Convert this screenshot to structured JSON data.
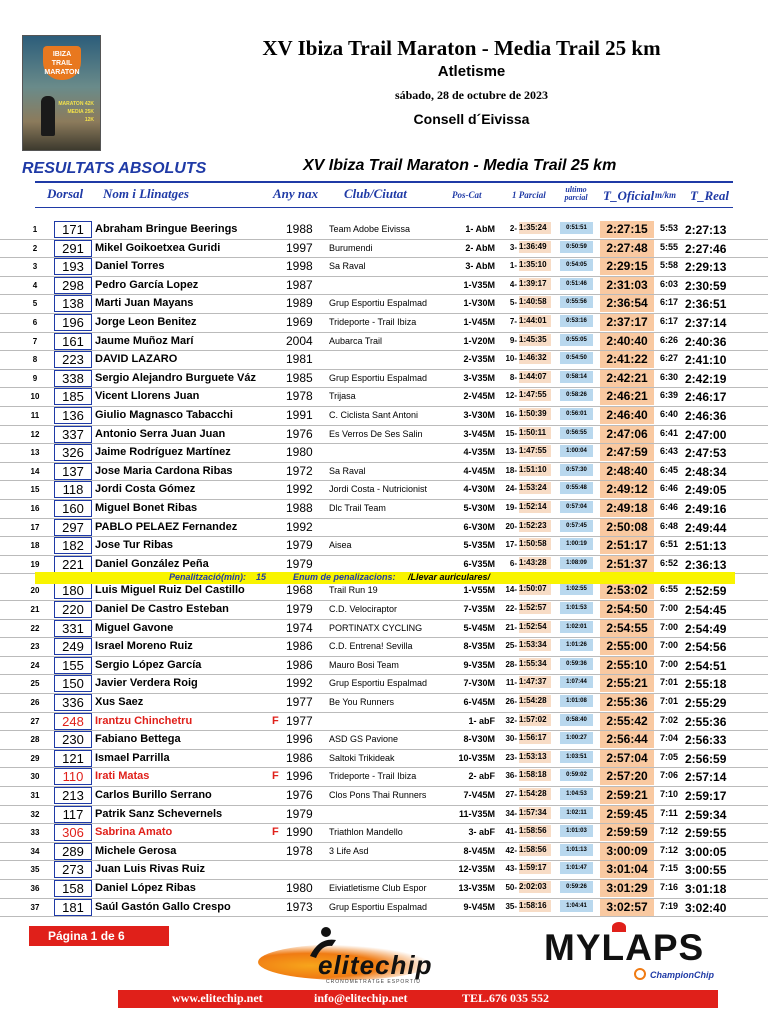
{
  "header": {
    "title": "XV Ibiza Trail Maraton - Media Trail 25 km",
    "subtitle": "Atletisme",
    "date": "sábado, 28 de octubre de 2023",
    "organizer": "Consell d´Eivissa"
  },
  "poster": {
    "lines": [
      "IBIZA",
      "TRAIL",
      "MARATON"
    ],
    "distances": [
      "MARATON 42K",
      "MEDIA 25K",
      "12K"
    ]
  },
  "section_title": "RESULTATS ABSOLUTS",
  "race_title": "XV Ibiza Trail Maraton - Media Trail 25 km",
  "columns": {
    "dorsal": "Dorsal",
    "name": "Nom i Llinatges",
    "year": "Any nax",
    "club": "Club/Ciutat",
    "poscat": "Pos-Cat",
    "parcial1": "1 Parcial",
    "ultimo": "ultimo parcial",
    "toficial": "T_Oficial",
    "mkm": "m/km",
    "treal": "T_Real"
  },
  "results": [
    {
      "pos": "1",
      "dorsal": "171",
      "name": "Abraham Bringue  Beerings",
      "sex": "",
      "year": "1988",
      "club": "Team Adobe Eivissa",
      "cat": "1- AbM",
      "p1pos": "2-",
      "p1": "1:35:24",
      "last": "0:51:51",
      "toficial": "2:27:15",
      "mkm": "5:53",
      "treal": "2:27:13"
    },
    {
      "pos": "2",
      "dorsal": "291",
      "name": "Mikel Goikoetxea Guridi",
      "sex": "",
      "year": "1997",
      "club": "Burumendi",
      "cat": "2- AbM",
      "p1pos": "3-",
      "p1": "1:36:49",
      "last": "0:50:59",
      "toficial": "2:27:48",
      "mkm": "5:55",
      "treal": "2:27:46"
    },
    {
      "pos": "3",
      "dorsal": "193",
      "name": "Daniel Torres",
      "sex": "",
      "year": "1998",
      "club": "Sa Raval",
      "cat": "3- AbM",
      "p1pos": "1-",
      "p1": "1:35:10",
      "last": "0:54:05",
      "toficial": "2:29:15",
      "mkm": "5:58",
      "treal": "2:29:13"
    },
    {
      "pos": "4",
      "dorsal": "298",
      "name": "Pedro García Lopez",
      "sex": "",
      "year": "1987",
      "club": "",
      "cat": "1-V35M",
      "p1pos": "4-",
      "p1": "1:39:17",
      "last": "0:51:46",
      "toficial": "2:31:03",
      "mkm": "6:03",
      "treal": "2:30:59"
    },
    {
      "pos": "5",
      "dorsal": "138",
      "name": "Marti Juan Mayans",
      "sex": "",
      "year": "1989",
      "club": "Grup Esportiu Espalmad",
      "cat": "1-V30M",
      "p1pos": "5-",
      "p1": "1:40:58",
      "last": "0:55:56",
      "toficial": "2:36:54",
      "mkm": "6:17",
      "treal": "2:36:51"
    },
    {
      "pos": "6",
      "dorsal": "196",
      "name": "Jorge Leon Benitez",
      "sex": "",
      "year": "1969",
      "club": "Trideporte - Trail Ibiza",
      "cat": "1-V45M",
      "p1pos": "7-",
      "p1": "1:44:01",
      "last": "0:53:16",
      "toficial": "2:37:17",
      "mkm": "6:17",
      "treal": "2:37:14"
    },
    {
      "pos": "7",
      "dorsal": "161",
      "name": "Jaume  Muñoz Marí",
      "sex": "",
      "year": "2004",
      "club": "Aubarca Trail",
      "cat": "1-V20M",
      "p1pos": "9-",
      "p1": "1:45:35",
      "last": "0:55:05",
      "toficial": "2:40:40",
      "mkm": "6:26",
      "treal": "2:40:36"
    },
    {
      "pos": "8",
      "dorsal": "223",
      "name": "DAVID LAZARO",
      "sex": "",
      "year": "1981",
      "club": "",
      "cat": "2-V35M",
      "p1pos": "10-",
      "p1": "1:46:32",
      "last": "0:54:50",
      "toficial": "2:41:22",
      "mkm": "6:27",
      "treal": "2:41:10"
    },
    {
      "pos": "9",
      "dorsal": "338",
      "name": "Sergio Alejandro Burguete  Váz",
      "sex": "",
      "year": "1985",
      "club": "Grup Esportiu Espalmad",
      "cat": "3-V35M",
      "p1pos": "8-",
      "p1": "1:44:07",
      "last": "0:58:14",
      "toficial": "2:42:21",
      "mkm": "6:30",
      "treal": "2:42:19"
    },
    {
      "pos": "10",
      "dorsal": "185",
      "name": "Vicent Llorens Juan",
      "sex": "",
      "year": "1978",
      "club": "Trijasa",
      "cat": "2-V45M",
      "p1pos": "12-",
      "p1": "1:47:55",
      "last": "0:58:26",
      "toficial": "2:46:21",
      "mkm": "6:39",
      "treal": "2:46:17"
    },
    {
      "pos": "11",
      "dorsal": "136",
      "name": "Giulio Magnasco Tabacchi",
      "sex": "",
      "year": "1991",
      "club": "C. Ciclista Sant Antoni",
      "cat": "3-V30M",
      "p1pos": "16-",
      "p1": "1:50:39",
      "last": "0:56:01",
      "toficial": "2:46:40",
      "mkm": "6:40",
      "treal": "2:46:36"
    },
    {
      "pos": "12",
      "dorsal": "337",
      "name": "Antonio Serra Juan Juan",
      "sex": "",
      "year": "1976",
      "club": "Es Verros De Ses Salin",
      "cat": "3-V45M",
      "p1pos": "15-",
      "p1": "1:50:11",
      "last": "0:56:55",
      "toficial": "2:47:06",
      "mkm": "6:41",
      "treal": "2:47:00"
    },
    {
      "pos": "13",
      "dorsal": "326",
      "name": "Jaime Rodríguez Martínez",
      "sex": "",
      "year": "1980",
      "club": "",
      "cat": "4-V35M",
      "p1pos": "13-",
      "p1": "1:47:55",
      "last": "1:00:04",
      "toficial": "2:47:59",
      "mkm": "6:43",
      "treal": "2:47:53"
    },
    {
      "pos": "14",
      "dorsal": "137",
      "name": "Jose Maria Cardona Ribas",
      "sex": "",
      "year": "1972",
      "club": "Sa Raval",
      "cat": "4-V45M",
      "p1pos": "18-",
      "p1": "1:51:10",
      "last": "0:57:30",
      "toficial": "2:48:40",
      "mkm": "6:45",
      "treal": "2:48:34"
    },
    {
      "pos": "15",
      "dorsal": "118",
      "name": "Jordi Costa Gómez",
      "sex": "",
      "year": "1992",
      "club": "Jordi Costa - Nutricionist",
      "cat": "4-V30M",
      "p1pos": "24-",
      "p1": "1:53:24",
      "last": "0:55:48",
      "toficial": "2:49:12",
      "mkm": "6:46",
      "treal": "2:49:05"
    },
    {
      "pos": "16",
      "dorsal": "160",
      "name": "Miguel Bonet Ribas",
      "sex": "",
      "year": "1988",
      "club": "Dlc Trail Team",
      "cat": "5-V30M",
      "p1pos": "19-",
      "p1": "1:52:14",
      "last": "0:57:04",
      "toficial": "2:49:18",
      "mkm": "6:46",
      "treal": "2:49:16"
    },
    {
      "pos": "17",
      "dorsal": "297",
      "name": "PABLO PELAEZ Fernandez",
      "sex": "",
      "year": "1992",
      "club": "",
      "cat": "6-V30M",
      "p1pos": "20-",
      "p1": "1:52:23",
      "last": "0:57:45",
      "toficial": "2:50:08",
      "mkm": "6:48",
      "treal": "2:49:44"
    },
    {
      "pos": "18",
      "dorsal": "182",
      "name": "Jose Tur Ribas",
      "sex": "",
      "year": "1979",
      "club": "Aisea",
      "cat": "5-V35M",
      "p1pos": "17-",
      "p1": "1:50:58",
      "last": "1:00:19",
      "toficial": "2:51:17",
      "mkm": "6:51",
      "treal": "2:51:13"
    },
    {
      "pos": "19",
      "dorsal": "221",
      "name": "Daniel González Peña",
      "sex": "",
      "year": "1979",
      "club": "",
      "cat": "6-V35M",
      "p1pos": "6-",
      "p1": "1:43:28",
      "last": "1:08:09",
      "toficial": "2:51:37",
      "mkm": "6:52",
      "treal": "2:36:13"
    },
    {
      "pos": "20",
      "dorsal": "180",
      "name": "Luis Miguel  Ruiz  Del Castillo",
      "sex": "",
      "year": "1968",
      "club": "Trail Run 19",
      "cat": "1-V55M",
      "p1pos": "14-",
      "p1": "1:50:07",
      "last": "1:02:55",
      "toficial": "2:53:02",
      "mkm": "6:55",
      "treal": "2:52:59"
    },
    {
      "pos": "21",
      "dorsal": "220",
      "name": "Daniel  De Castro  Esteban",
      "sex": "",
      "year": "1979",
      "club": "C.D. Velociraptor",
      "cat": "7-V35M",
      "p1pos": "22-",
      "p1": "1:52:57",
      "last": "1:01:53",
      "toficial": "2:54:50",
      "mkm": "7:00",
      "treal": "2:54:45"
    },
    {
      "pos": "22",
      "dorsal": "331",
      "name": "Miguel Gavone",
      "sex": "",
      "year": "1974",
      "club": "PORTINATX CYCLING",
      "cat": "5-V45M",
      "p1pos": "21-",
      "p1": "1:52:54",
      "last": "1:02:01",
      "toficial": "2:54:55",
      "mkm": "7:00",
      "treal": "2:54:49"
    },
    {
      "pos": "23",
      "dorsal": "249",
      "name": "Israel Moreno  Ruiz",
      "sex": "",
      "year": "1986",
      "club": "C.D. Entrena! Sevilla",
      "cat": "8-V35M",
      "p1pos": "25-",
      "p1": "1:53:34",
      "last": "1:01:26",
      "toficial": "2:55:00",
      "mkm": "7:00",
      "treal": "2:54:56"
    },
    {
      "pos": "24",
      "dorsal": "155",
      "name": "Sergio López García",
      "sex": "",
      "year": "1986",
      "club": "Mauro Bosi Team",
      "cat": "9-V35M",
      "p1pos": "28-",
      "p1": "1:55:34",
      "last": "0:59:36",
      "toficial": "2:55:10",
      "mkm": "7:00",
      "treal": "2:54:51"
    },
    {
      "pos": "25",
      "dorsal": "150",
      "name": "Javier Verdera Roig",
      "sex": "",
      "year": "1992",
      "club": "Grup Esportiu Espalmad",
      "cat": "7-V30M",
      "p1pos": "11-",
      "p1": "1:47:37",
      "last": "1:07:44",
      "toficial": "2:55:21",
      "mkm": "7:01",
      "treal": "2:55:18"
    },
    {
      "pos": "26",
      "dorsal": "336",
      "name": "Xus Saez",
      "sex": "",
      "year": "1977",
      "club": "Be You Runners",
      "cat": "6-V45M",
      "p1pos": "26-",
      "p1": "1:54:28",
      "last": "1:01:08",
      "toficial": "2:55:36",
      "mkm": "7:01",
      "treal": "2:55:29"
    },
    {
      "pos": "27",
      "dorsal": "248",
      "name": "Irantzu Chinchetru",
      "sex": "F",
      "year": "1977",
      "club": "",
      "cat": "1- abF",
      "p1pos": "32-",
      "p1": "1:57:02",
      "last": "0:58:40",
      "toficial": "2:55:42",
      "mkm": "7:02",
      "treal": "2:55:36",
      "red": true
    },
    {
      "pos": "28",
      "dorsal": "230",
      "name": "Fabiano Bettega",
      "sex": "",
      "year": "1996",
      "club": "ASD GS Pavione",
      "cat": "8-V30M",
      "p1pos": "30-",
      "p1": "1:56:17",
      "last": "1:00:27",
      "toficial": "2:56:44",
      "mkm": "7:04",
      "treal": "2:56:33"
    },
    {
      "pos": "29",
      "dorsal": "121",
      "name": "Ismael Parrilla",
      "sex": "",
      "year": "1986",
      "club": "Saltoki Trikideak",
      "cat": "10-V35M",
      "p1pos": "23-",
      "p1": "1:53:13",
      "last": "1:03:51",
      "toficial": "2:57:04",
      "mkm": "7:05",
      "treal": "2:56:59"
    },
    {
      "pos": "30",
      "dorsal": "110",
      "name": "Irati Matas",
      "sex": "F",
      "year": "1996",
      "club": "Trideporte - Trail Ibiza",
      "cat": "2- abF",
      "p1pos": "36-",
      "p1": "1:58:18",
      "last": "0:59:02",
      "toficial": "2:57:20",
      "mkm": "7:06",
      "treal": "2:57:14",
      "red": true
    },
    {
      "pos": "31",
      "dorsal": "213",
      "name": "Carlos  Burillo Serrano",
      "sex": "",
      "year": "1976",
      "club": "Clos Pons Thai Runners",
      "cat": "7-V45M",
      "p1pos": "27-",
      "p1": "1:54:28",
      "last": "1:04:53",
      "toficial": "2:59:21",
      "mkm": "7:10",
      "treal": "2:59:17"
    },
    {
      "pos": "32",
      "dorsal": "117",
      "name": "Patrik  Sanz  Schevernels",
      "sex": "",
      "year": "1979",
      "club": "",
      "cat": "11-V35M",
      "p1pos": "34-",
      "p1": "1:57:34",
      "last": "1:02:11",
      "toficial": "2:59:45",
      "mkm": "7:11",
      "treal": "2:59:34"
    },
    {
      "pos": "33",
      "dorsal": "306",
      "name": "Sabrina Amato",
      "sex": "F",
      "year": "1990",
      "club": "Triathlon Mandello",
      "cat": "3- abF",
      "p1pos": "41-",
      "p1": "1:58:56",
      "last": "1:01:03",
      "toficial": "2:59:59",
      "mkm": "7:12",
      "treal": "2:59:55",
      "red": true
    },
    {
      "pos": "34",
      "dorsal": "289",
      "name": "Michele Gerosa",
      "sex": "",
      "year": "1978",
      "club": "3 Life Asd",
      "cat": "8-V45M",
      "p1pos": "42-",
      "p1": "1:58:56",
      "last": "1:01:13",
      "toficial": "3:00:09",
      "mkm": "7:12",
      "treal": "3:00:05"
    },
    {
      "pos": "35",
      "dorsal": "273",
      "name": "Juan Luis Rivas Ruiz",
      "sex": "",
      "year": "",
      "club": "",
      "cat": "12-V35M",
      "p1pos": "43-",
      "p1": "1:59:17",
      "last": "1:01:47",
      "toficial": "3:01:04",
      "mkm": "7:15",
      "treal": "3:00:55"
    },
    {
      "pos": "36",
      "dorsal": "158",
      "name": "Daniel López Ribas",
      "sex": "",
      "year": "1980",
      "club": "Eiviatletisme Club Espor",
      "cat": "13-V35M",
      "p1pos": "50-",
      "p1": "2:02:03",
      "last": "0:59:26",
      "toficial": "3:01:29",
      "mkm": "7:16",
      "treal": "3:01:18"
    },
    {
      "pos": "37",
      "dorsal": "181",
      "name": "Saúl Gastón Gallo Crespo",
      "sex": "",
      "year": "1973",
      "club": "Grup Esportiu Espalmad",
      "cat": "9-V45M",
      "p1pos": "35-",
      "p1": "1:58:16",
      "last": "1:04:41",
      "toficial": "3:02:57",
      "mkm": "7:19",
      "treal": "3:02:40"
    }
  ],
  "penalty": {
    "label": "Penalització(min):",
    "minutes": "15",
    "reason_label": "Enum de penalizacions:",
    "reason": "/Llevar auriculares/"
  },
  "page_label": "Página 1 de 6",
  "logos": {
    "elitechip": "elitechip",
    "elitechip_sub": "CRONOMETRATGE ESPORTIU",
    "mylaps": "MYLAPS",
    "championchip": "ChampionChip"
  },
  "footer": {
    "website": "www.elitechip.net",
    "email": "info@elitechip.net",
    "phone": "TEL.676 035 552"
  },
  "colors": {
    "accent_blue": "#1f3aa6",
    "red": "#e0201a",
    "toficial_bg": "#f9c9a1",
    "parcial_bg": "#f7dcc6",
    "ultimo_bg": "#b9d8ee",
    "penalty_bg": "#f9f400"
  }
}
